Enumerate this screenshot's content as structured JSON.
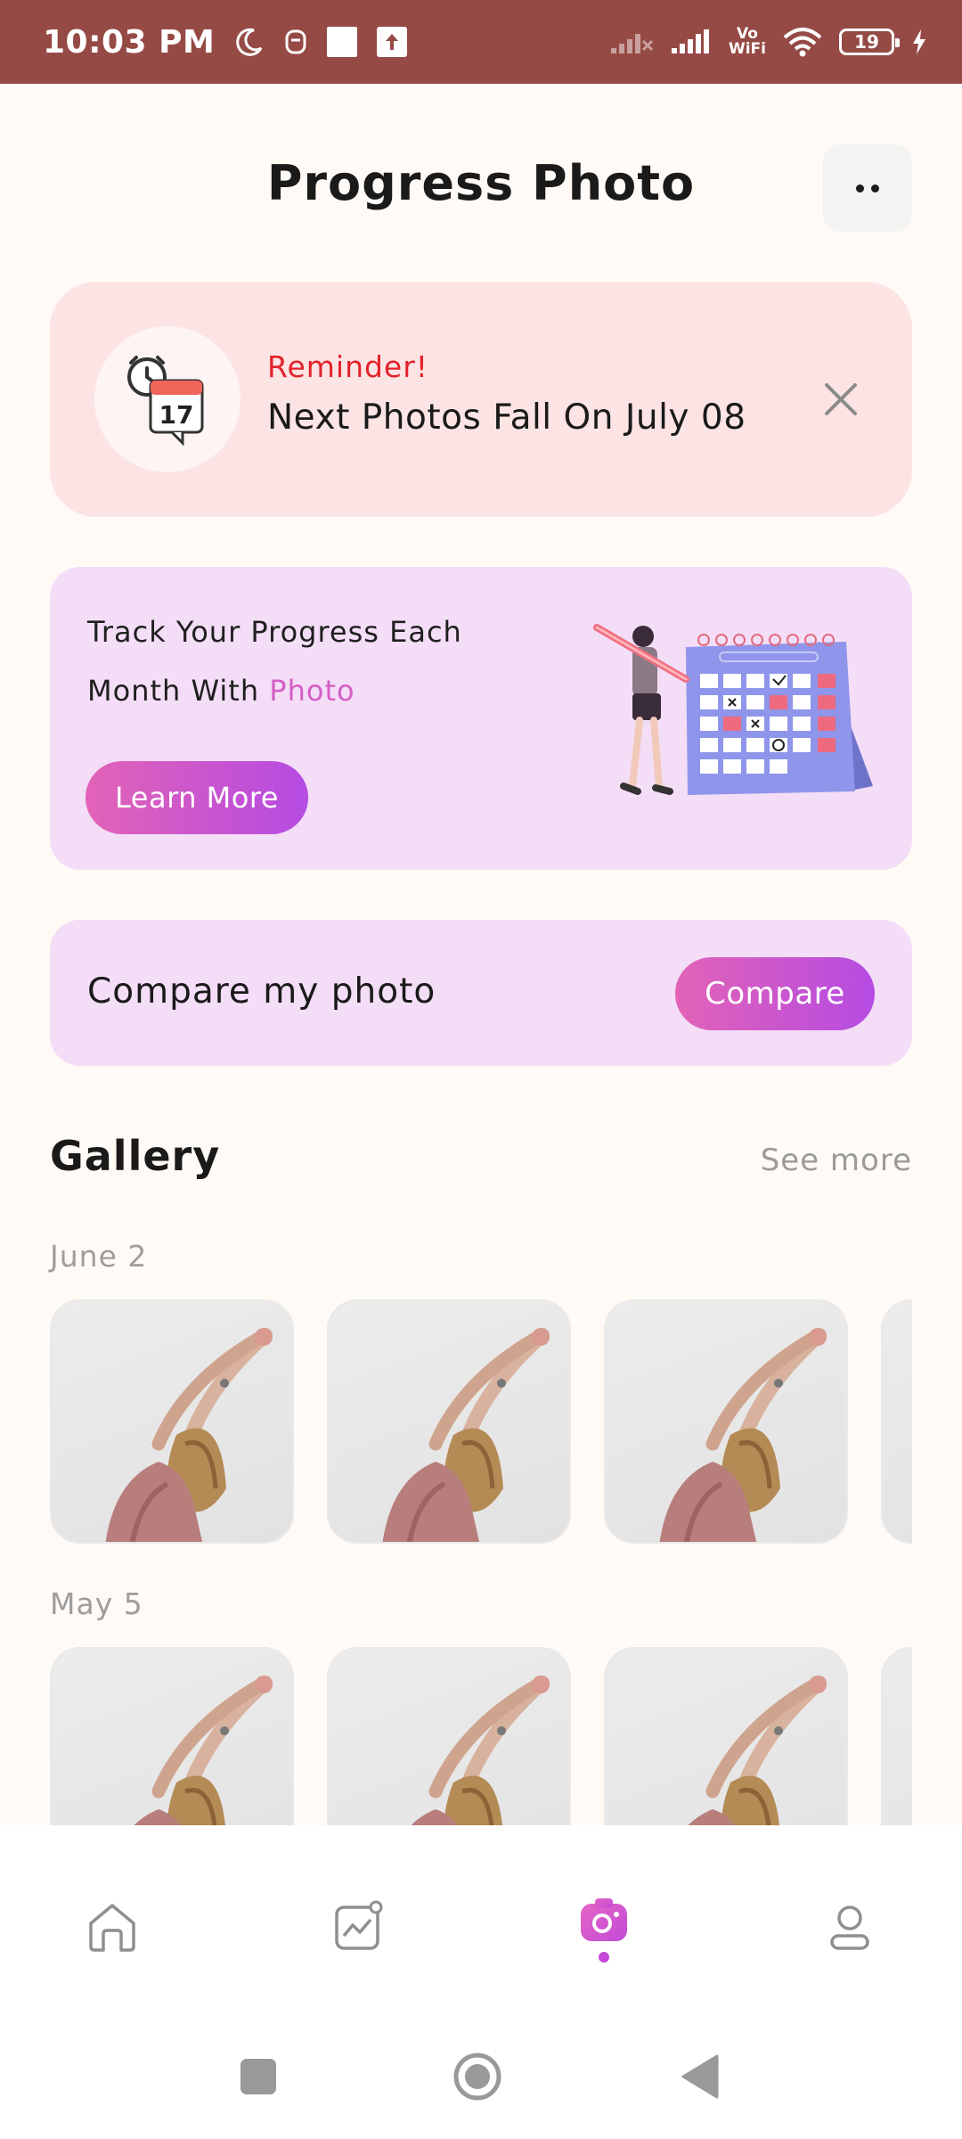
{
  "status_bar": {
    "time": "10:03 PM",
    "battery": "19",
    "network_label_top": "Vo",
    "network_label_bottom": "WiFi"
  },
  "header": {
    "title": "Progress Photo"
  },
  "reminder": {
    "label": "Reminder!",
    "text": "Next Photos Fall On July 08",
    "calendar_day": "17"
  },
  "promo": {
    "line_1": "Track Your Progress Each",
    "line_2_prefix": "Month With ",
    "line_2_highlight": "Photo",
    "button_label": "Learn More"
  },
  "compare": {
    "label": "Compare my photo",
    "button_label": "Compare"
  },
  "gallery": {
    "title": "Gallery",
    "see_more": "See more",
    "groups": [
      {
        "date": "June 2"
      },
      {
        "date": "May 5"
      }
    ]
  },
  "bottom_nav": {
    "items": [
      {
        "icon": "home-icon"
      },
      {
        "icon": "chart-icon"
      },
      {
        "icon": "camera-icon",
        "active": true
      },
      {
        "icon": "profile-icon"
      }
    ]
  },
  "colors": {
    "status_bar": "#964a45",
    "accent": "#c34ad8",
    "reminder_red": "#e3222b",
    "promo_bg": "#f4ddf7",
    "reminder_bg": "#fde4e4"
  }
}
